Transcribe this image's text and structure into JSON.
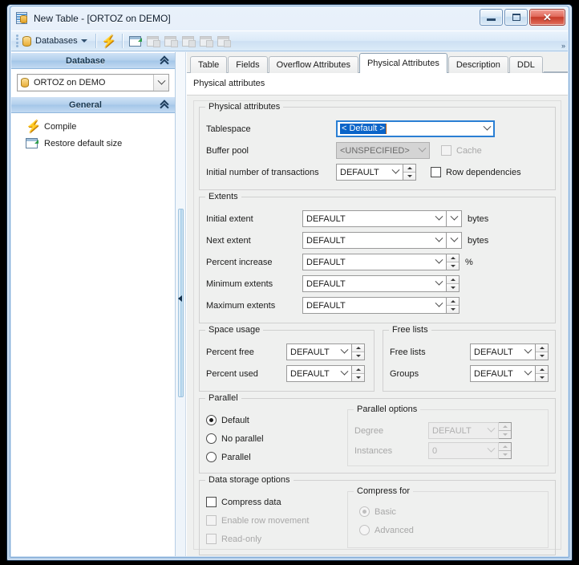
{
  "window": {
    "title": "New Table - [ORTOZ on DEMO]",
    "icon": "table-document-icon",
    "minimize_label": "Minimize",
    "maximize_label": "Maximize",
    "close_label": "Close"
  },
  "toolbar": {
    "databases_label": "Databases",
    "icons": [
      "databases-dropdown-icon",
      "compile-lightning-icon",
      "restore-default-size-icon",
      "new-table-icon",
      "edit-table-icon",
      "drop-table-icon",
      "duplicate-table-icon",
      "new-field-icon"
    ],
    "overflow_label": "»"
  },
  "sidebar": {
    "sections": [
      {
        "title": "Database",
        "collapse_icon": "chevron-double-up-icon",
        "combo": {
          "value": "ORTOZ on DEMO",
          "icon": "database-icon",
          "arrow_icon": "chevron-down-icon"
        }
      },
      {
        "title": "General",
        "collapse_icon": "chevron-double-up-icon",
        "actions": [
          {
            "label": "Compile",
            "icon": "lightning-bolt-icon"
          },
          {
            "label": "Restore default size",
            "icon": "restore-window-icon"
          }
        ]
      }
    ]
  },
  "splitter": {
    "collapse_icon": "chevron-left-icon"
  },
  "tabs": {
    "items": [
      {
        "label": "Table",
        "active": false
      },
      {
        "label": "Fields",
        "active": false
      },
      {
        "label": "Overflow Attributes",
        "active": false
      },
      {
        "label": "Physical Attributes",
        "active": true
      },
      {
        "label": "Description",
        "active": false
      },
      {
        "label": "DDL",
        "active": false
      }
    ]
  },
  "panel": {
    "title": "Physical attributes"
  },
  "physical_attributes": {
    "legend": "Physical attributes",
    "tablespace": {
      "label": "Tablespace",
      "value": "< Default >",
      "focused": true,
      "arrow_icon": "chevron-down-icon"
    },
    "buffer_pool": {
      "label": "Buffer pool",
      "value": "<UNSPECIFIED>",
      "disabled": true,
      "arrow_icon": "chevron-down-icon"
    },
    "cache": {
      "label": "Cache",
      "checked": false,
      "disabled": true
    },
    "initial_transactions": {
      "label": "Initial number of transactions",
      "value": "DEFAULT",
      "arrow_icon": "chevron-down-icon",
      "spinner_icon": "spinner-up-down-icon"
    },
    "row_dependencies": {
      "label": "Row dependencies",
      "checked": false
    }
  },
  "extents": {
    "legend": "Extents",
    "rows": [
      {
        "label": "Initial extent",
        "value": "DEFAULT",
        "control": "combo-unit",
        "unit": "bytes"
      },
      {
        "label": "Next extent",
        "value": "DEFAULT",
        "control": "combo-unit",
        "unit": "bytes"
      },
      {
        "label": "Percent increase",
        "value": "DEFAULT",
        "control": "combo-spin",
        "unit": "%"
      },
      {
        "label": "Minimum extents",
        "value": "DEFAULT",
        "control": "combo-spin",
        "unit": ""
      },
      {
        "label": "Maximum extents",
        "value": "DEFAULT",
        "control": "combo-spin",
        "unit": ""
      }
    ]
  },
  "space_usage": {
    "legend": "Space usage",
    "rows": [
      {
        "label": "Percent free",
        "value": "DEFAULT"
      },
      {
        "label": "Percent used",
        "value": "DEFAULT"
      }
    ]
  },
  "free_lists": {
    "legend": "Free lists",
    "rows": [
      {
        "label": "Free lists",
        "value": "DEFAULT"
      },
      {
        "label": "Groups",
        "value": "DEFAULT"
      }
    ]
  },
  "parallel": {
    "legend": "Parallel",
    "options": [
      {
        "label": "Default",
        "checked": true
      },
      {
        "label": "No parallel",
        "checked": false
      },
      {
        "label": "Parallel",
        "checked": false
      }
    ],
    "parallel_options": {
      "legend": "Parallel options",
      "disabled": true,
      "rows": [
        {
          "label": "Degree",
          "value": "DEFAULT"
        },
        {
          "label": "Instances",
          "value": "0"
        }
      ]
    }
  },
  "data_storage": {
    "legend": "Data storage options",
    "options": [
      {
        "label": "Compress data",
        "checked": false,
        "disabled": false
      },
      {
        "label": "Enable row movement",
        "checked": false,
        "disabled": true
      },
      {
        "label": "Read-only",
        "checked": false,
        "disabled": true
      }
    ],
    "compress_for": {
      "legend": "Compress for",
      "disabled": true,
      "options": [
        {
          "label": "Basic",
          "checked": true
        },
        {
          "label": "Advanced",
          "checked": false
        }
      ]
    }
  },
  "colors": {
    "accent": "#0a64c8",
    "title_bar": "#cfe0f2",
    "section_header": "#b3d0ec",
    "form_bg": "#eff0ef",
    "lightning": "#f0a30a"
  }
}
